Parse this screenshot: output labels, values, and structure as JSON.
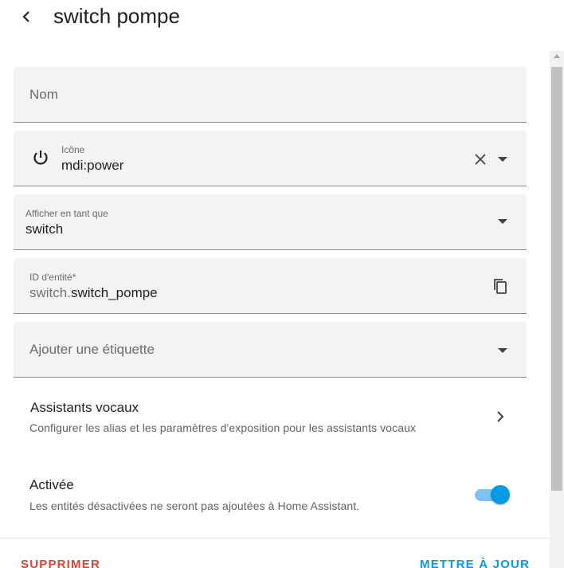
{
  "header": {
    "title": "switch pompe",
    "back_icon": "chevron-left-icon"
  },
  "fields": {
    "name": {
      "placeholder": "Nom",
      "value": ""
    },
    "icon": {
      "label": "Icône",
      "value": "mdi:power",
      "leading_icon": "power-icon",
      "clear_icon": "close-icon",
      "dropdown_icon": "menu-down-icon"
    },
    "display_as": {
      "label": "Afficher en tant que",
      "value": "switch",
      "dropdown_icon": "menu-down-icon"
    },
    "entity_id": {
      "label": "ID d'entité*",
      "prefix": "switch.",
      "value": "switch_pompe",
      "copy_icon": "copy-icon"
    },
    "labels": {
      "placeholder": "Ajouter une étiquette",
      "dropdown_icon": "menu-down-icon"
    }
  },
  "voice_assistants": {
    "title": "Assistants vocaux",
    "description": "Configurer les alias et les paramètres d'exposition pour les assistants vocaux",
    "chevron_icon": "chevron-right-icon"
  },
  "enabled": {
    "title": "Activée",
    "description": "Les entités désactivées ne seront pas ajoutées à Home Assistant.",
    "state": "on"
  },
  "footer": {
    "delete_label": "SUPPRIMER",
    "update_label": "METTRE À JOUR"
  },
  "colors": {
    "accent": "#039be5",
    "danger": "#db4437",
    "field_bg": "#f3f3f3"
  }
}
